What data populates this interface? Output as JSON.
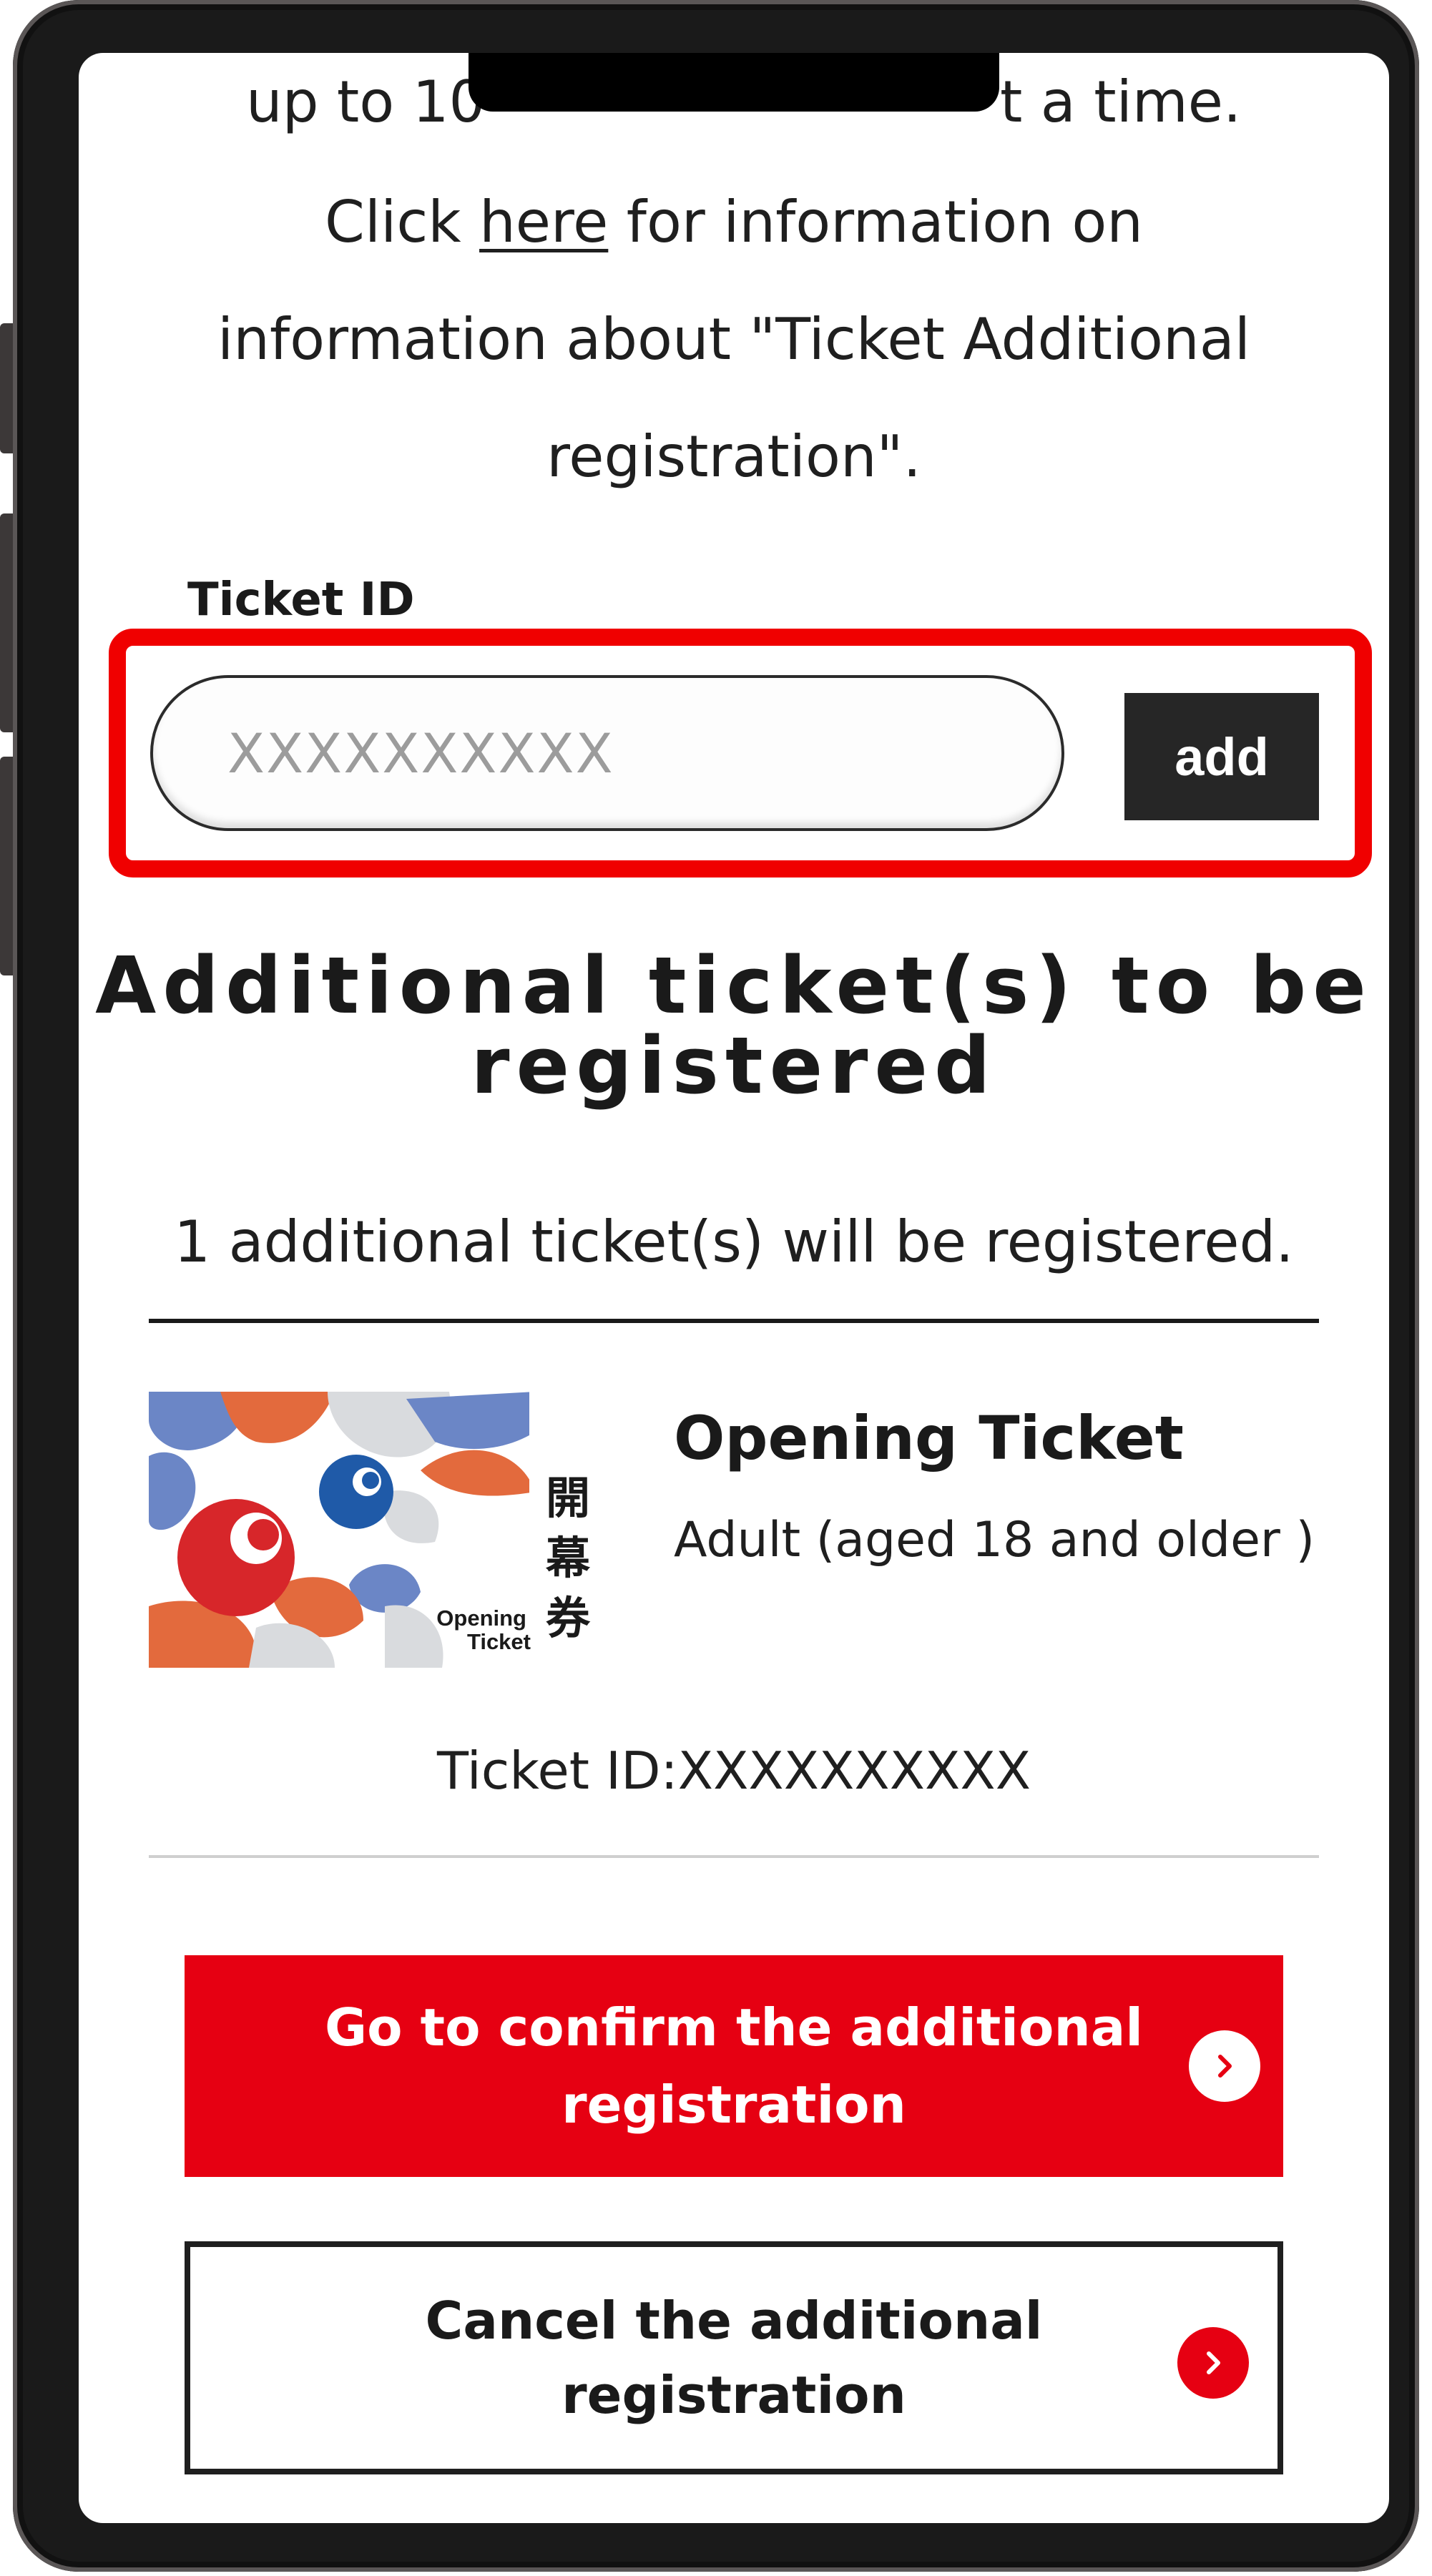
{
  "intro": {
    "line1_visible_start": "up to 10",
    "line1_visible_end": "t a time.",
    "line2_prefix": "Click ",
    "line2_link": "here",
    "line2_suffix": " for information on",
    "line3": "information about \"Ticket Additional",
    "line4": "registration\"."
  },
  "ticket_form": {
    "label": "Ticket ID",
    "input_placeholder": "XXXXXXXXXX",
    "input_value": "",
    "add_button": "add"
  },
  "additional": {
    "title_line1": "Additional ticket(s) to be",
    "title_line2": "registered",
    "count_text": "1 additional ticket(s) will be registered."
  },
  "ticket": {
    "image_label_en_1": "Opening",
    "image_label_en_2": "Ticket",
    "image_label_jp": [
      "開",
      "幕",
      "券"
    ],
    "name": "Opening Ticket",
    "type": "Adult (aged 18 and older )",
    "id_text": "Ticket ID:XXXXXXXXXX"
  },
  "actions": {
    "confirm_line1": "Go to confirm the additional",
    "confirm_line2": "registration",
    "cancel_line1": "Cancel the additional",
    "cancel_line2": "registration"
  },
  "icons": {
    "confirm_icon": "chevron-right-circle-icon",
    "cancel_icon": "chevron-right-circle-icon"
  },
  "colors": {
    "primary_red": "#e60012",
    "highlight_red": "#f00000",
    "dark": "#262626",
    "text": "#1f1f1f"
  }
}
